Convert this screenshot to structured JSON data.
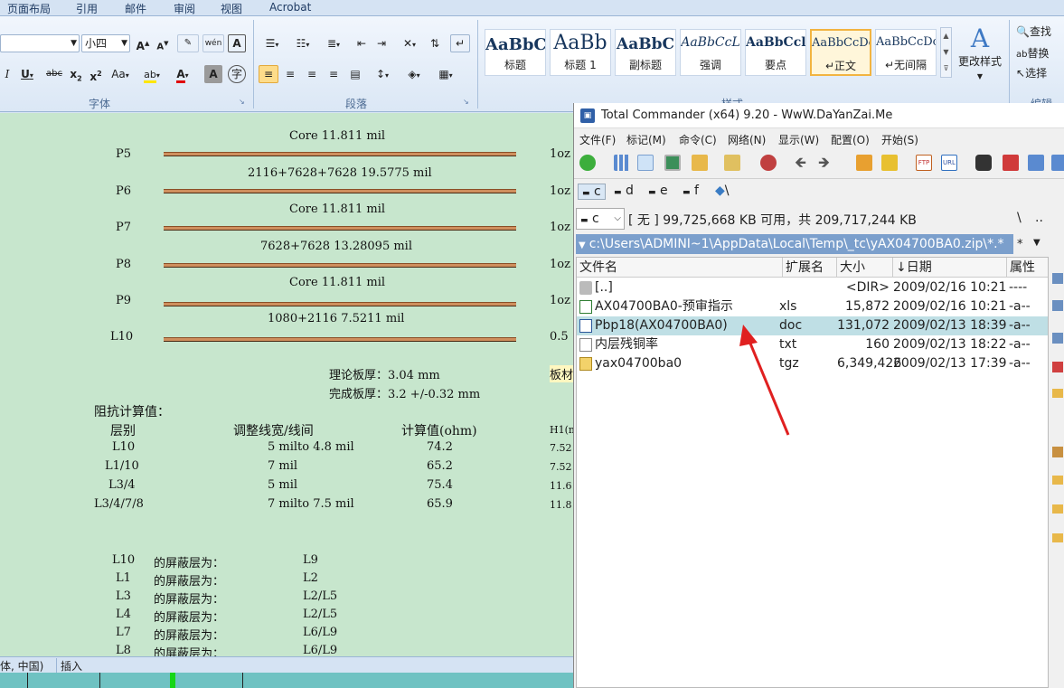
{
  "word": {
    "tabs": [
      "页面布局",
      "引用",
      "邮件",
      "审阅",
      "视图",
      "Acrobat"
    ],
    "font_group_label": "字体",
    "paragraph_group_label": "段落",
    "styles_group_label": "样式",
    "editing_group_label": "编辑",
    "font_size": "小四",
    "styles": [
      {
        "sample": "AaBbC",
        "name": "标题"
      },
      {
        "sample": "AaBb",
        "name": "标题 1"
      },
      {
        "sample": "AaBbC",
        "name": "副标题"
      },
      {
        "sample": "AaBbCcL",
        "name": "强调"
      },
      {
        "sample": "AaBbCcl",
        "name": "要点"
      },
      {
        "sample": "AaBbCcDc",
        "name": "↵正文"
      },
      {
        "sample": "AaBbCcDc",
        "name": "↵无间隔"
      }
    ],
    "change_styles": "更改样式",
    "find": "查找",
    "replace": "替换",
    "select": "选择",
    "status_left": "体, 中国)",
    "status_insert": "插入"
  },
  "document": {
    "layers": [
      {
        "label": "P5",
        "spec": "Core    11.811 mil",
        "right": "1oz"
      },
      {
        "label": "P6",
        "spec": "2116+7628+7628     19.5775 mil",
        "right": "1oz"
      },
      {
        "label": "P7",
        "spec": "Core    11.811 mil",
        "right": "1oz"
      },
      {
        "label": "P8",
        "spec": "7628+7628     13.28095 mil",
        "right": "1oz"
      },
      {
        "label": "P9",
        "spec": "Core    11.811 mil",
        "right": "1oz"
      },
      {
        "label": "L10",
        "spec": "1080+2116     7.5211 mil",
        "right": "0.5"
      }
    ],
    "theory_thickness": "理论板厚：3.04 mm",
    "final_thickness": "完成板厚：3.2 +/-0.32 mm",
    "board_label": "板材",
    "impedance_title": "阻抗计算值：",
    "table_headers": [
      "层别",
      "调整线宽/线间",
      "计算值(ohm)",
      "H1(m"
    ],
    "table_rows": [
      {
        "layer": "L10",
        "width": "5 milto  4.8 mil",
        "value": "74.2",
        "h1": "7.52"
      },
      {
        "layer": "L1/10",
        "width": "7 mil",
        "value": "65.2",
        "h1": "7.52"
      },
      {
        "layer": "L3/4",
        "width": "5 mil",
        "value": "75.4",
        "h1": "11.6"
      },
      {
        "layer": "L3/4/7/8",
        "width": "7 milto  7.5 mil",
        "value": "65.9",
        "h1": "11.8"
      }
    ],
    "shield_text": "的屏蔽层为：",
    "shields": [
      {
        "layer": "L10",
        "shield": "L9"
      },
      {
        "layer": "L1",
        "shield": "L2"
      },
      {
        "layer": "L3",
        "shield": "L2/L5"
      },
      {
        "layer": "L4",
        "shield": "L2/L5"
      },
      {
        "layer": "L7",
        "shield": "L6/L9"
      },
      {
        "layer": "L8",
        "shield": "L6/L9"
      }
    ]
  },
  "tc": {
    "title": "Total Commander (x64) 9.20 - WwW.DaYanZai.Me",
    "menu": [
      "文件(F)",
      "标记(M)",
      "命令(C)",
      "网络(N)",
      "显示(W)",
      "配置(O)",
      "开始(S)"
    ],
    "drives": [
      "c",
      "d",
      "e",
      "f",
      "\\"
    ],
    "current_drive": "c",
    "volume_info": "[ 无 ]  99,725,668 KB 可用，共 209,717,244 KB",
    "root_btn": "\\",
    "up_btn": "..",
    "path": "c:\\Users\\ADMINI~1\\AppData\\Local\\Temp\\_tc\\yAX04700BA0.zip\\*.*",
    "filter": "*",
    "columns": [
      "文件名",
      "扩展名",
      "大小",
      "↓日期",
      "属性"
    ],
    "files": [
      {
        "name": "[..]",
        "ext": "",
        "size": "<DIR>",
        "date": "2009/02/16 10:21",
        "attr": "----",
        "icon": "up-folder-icon"
      },
      {
        "name": "AX04700BA0-预审指示",
        "ext": "xls",
        "size": "15,872",
        "date": "2009/02/16 10:21",
        "attr": "-a--",
        "icon": "excel-file-icon"
      },
      {
        "name": "Pbp18(AX04700BA0)",
        "ext": "doc",
        "size": "131,072",
        "date": "2009/02/13 18:39",
        "attr": "-a--",
        "icon": "word-file-icon"
      },
      {
        "name": "内层残铜率",
        "ext": "txt",
        "size": "160",
        "date": "2009/02/13 18:22",
        "attr": "-a--",
        "icon": "text-file-icon"
      },
      {
        "name": "yax04700ba0",
        "ext": "tgz",
        "size": "6,349,426",
        "date": "2009/02/13 17:39",
        "attr": "-a--",
        "icon": "archive-file-icon"
      }
    ],
    "selected_index": 2
  },
  "colors": {
    "doc_bg": "#c7e6cd",
    "selection": "#bfdfe5",
    "path_bar": "#7b9fcc",
    "arrow": "#e02020"
  }
}
